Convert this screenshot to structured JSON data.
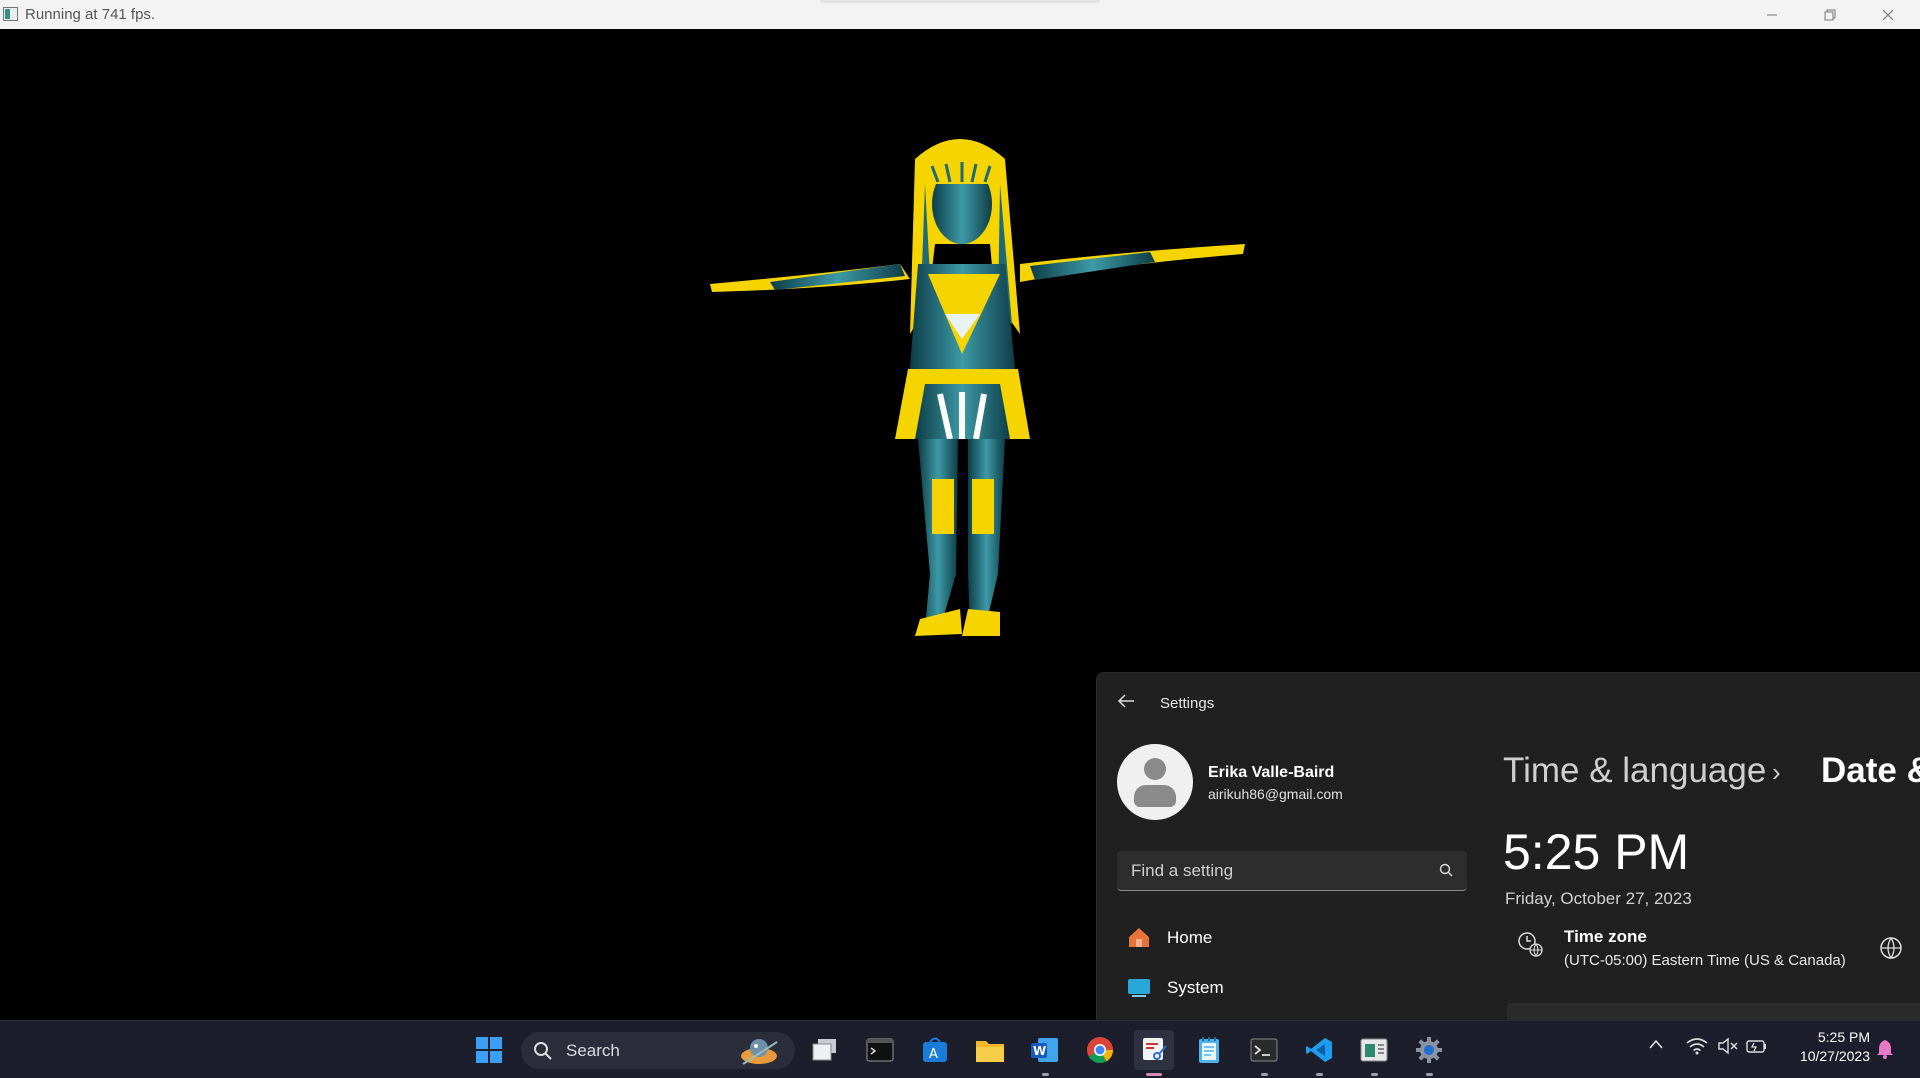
{
  "window": {
    "title": "Running at 741 fps.",
    "controls": [
      "minimize",
      "restore",
      "close"
    ]
  },
  "settings": {
    "app_title": "Settings",
    "user": {
      "name": "Erika Valle-Baird",
      "email": "airikuh86@gmail.com"
    },
    "search_placeholder": "Find a setting",
    "nav": [
      {
        "label": "Home",
        "icon": "home-icon"
      },
      {
        "label": "System",
        "icon": "system-icon"
      }
    ],
    "breadcrumb": {
      "parent": "Time & language",
      "current": "Date &"
    },
    "time": "5:25 PM",
    "date": "Friday, October 27, 2023",
    "timezone": {
      "label": "Time zone",
      "value": "(UTC-05:00) Eastern Time (US & Canada)"
    }
  },
  "taskbar": {
    "search_label": "Search",
    "apps": [
      "start",
      "task-view",
      "terminal",
      "app-store",
      "file-explorer",
      "word",
      "chrome",
      "snipping-tool",
      "notepad",
      "terminal-admin",
      "vscode",
      "sheets-app",
      "settings"
    ],
    "clock": {
      "time": "5:25 PM",
      "date": "10/27/2023"
    }
  },
  "colors": {
    "figure_primary": "#f5d400",
    "figure_secondary": "#1e6a78",
    "settings_bg": "#202020",
    "taskbar_bg": "#1c1f2b"
  }
}
